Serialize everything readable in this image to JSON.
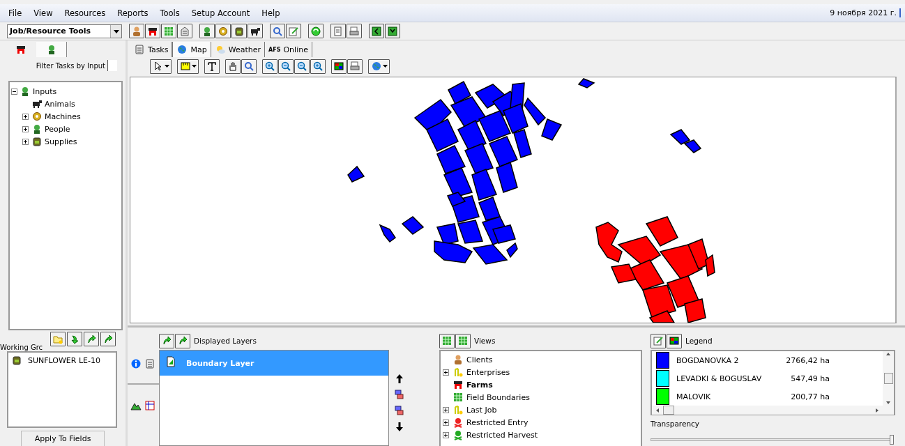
{
  "menu": [
    "File",
    "View",
    "Resources",
    "Reports",
    "Tools",
    "Setup Account",
    "Help"
  ],
  "date": "9 ноября 2021 г.",
  "tool_select": {
    "value": "Job/Resource Tools"
  },
  "left_tabs": [
    {
      "selected": false
    },
    {
      "selected": true
    }
  ],
  "main_tabs": [
    {
      "label": "Tasks",
      "selected": false
    },
    {
      "label": "Map",
      "selected": true
    },
    {
      "label": "Weather",
      "selected": false
    },
    {
      "label": "Online",
      "badge": "AFS",
      "selected": false
    }
  ],
  "filter_label": "Filter Tasks by Input",
  "filter_checked": false,
  "inputs_tree": [
    {
      "label": "Inputs",
      "expanded": true,
      "children": [
        {
          "label": "Animals",
          "kind": "leaf"
        },
        {
          "label": "Machines",
          "kind": "group",
          "expanded": false
        },
        {
          "label": "People",
          "kind": "group",
          "expanded": false
        },
        {
          "label": "Supplies",
          "kind": "group",
          "expanded": false
        }
      ]
    }
  ],
  "working_group": {
    "label": "Working Grc",
    "items": [
      "SUNFLOWER LE-10"
    ]
  },
  "apply_button": "Apply To Fields",
  "layers": {
    "title": "Displayed Layers",
    "items": [
      {
        "label": "Boundary Layer",
        "selected": true
      }
    ]
  },
  "views": {
    "title": "Views",
    "items": [
      {
        "label": "Clients",
        "kind": "leaf",
        "selected": false
      },
      {
        "label": "Enterprises",
        "kind": "group",
        "expanded": false,
        "selected": false
      },
      {
        "label": "Farms",
        "kind": "leaf",
        "selected": true
      },
      {
        "label": "Field Boundaries",
        "kind": "leaf",
        "selected": false
      },
      {
        "label": "Last Job",
        "kind": "group",
        "expanded": false,
        "selected": false
      },
      {
        "label": "Restricted Entry",
        "kind": "group",
        "expanded": false,
        "selected": false
      },
      {
        "label": "Restricted Harvest",
        "kind": "group",
        "expanded": false,
        "selected": false
      }
    ]
  },
  "legend": {
    "title": "Legend",
    "items": [
      {
        "name": "BOGDANOVKA 2",
        "area": "2766,42 ha",
        "color": "#0000ff"
      },
      {
        "name": "LEVADKI & BOGUSLAV",
        "area": "547,49 ha",
        "color": "#00ffff"
      },
      {
        "name": "MALOVIK",
        "area": "200,77 ha",
        "color": "#00ff00"
      }
    ],
    "transparency": {
      "label": "Transparency",
      "level": 1.0
    }
  }
}
